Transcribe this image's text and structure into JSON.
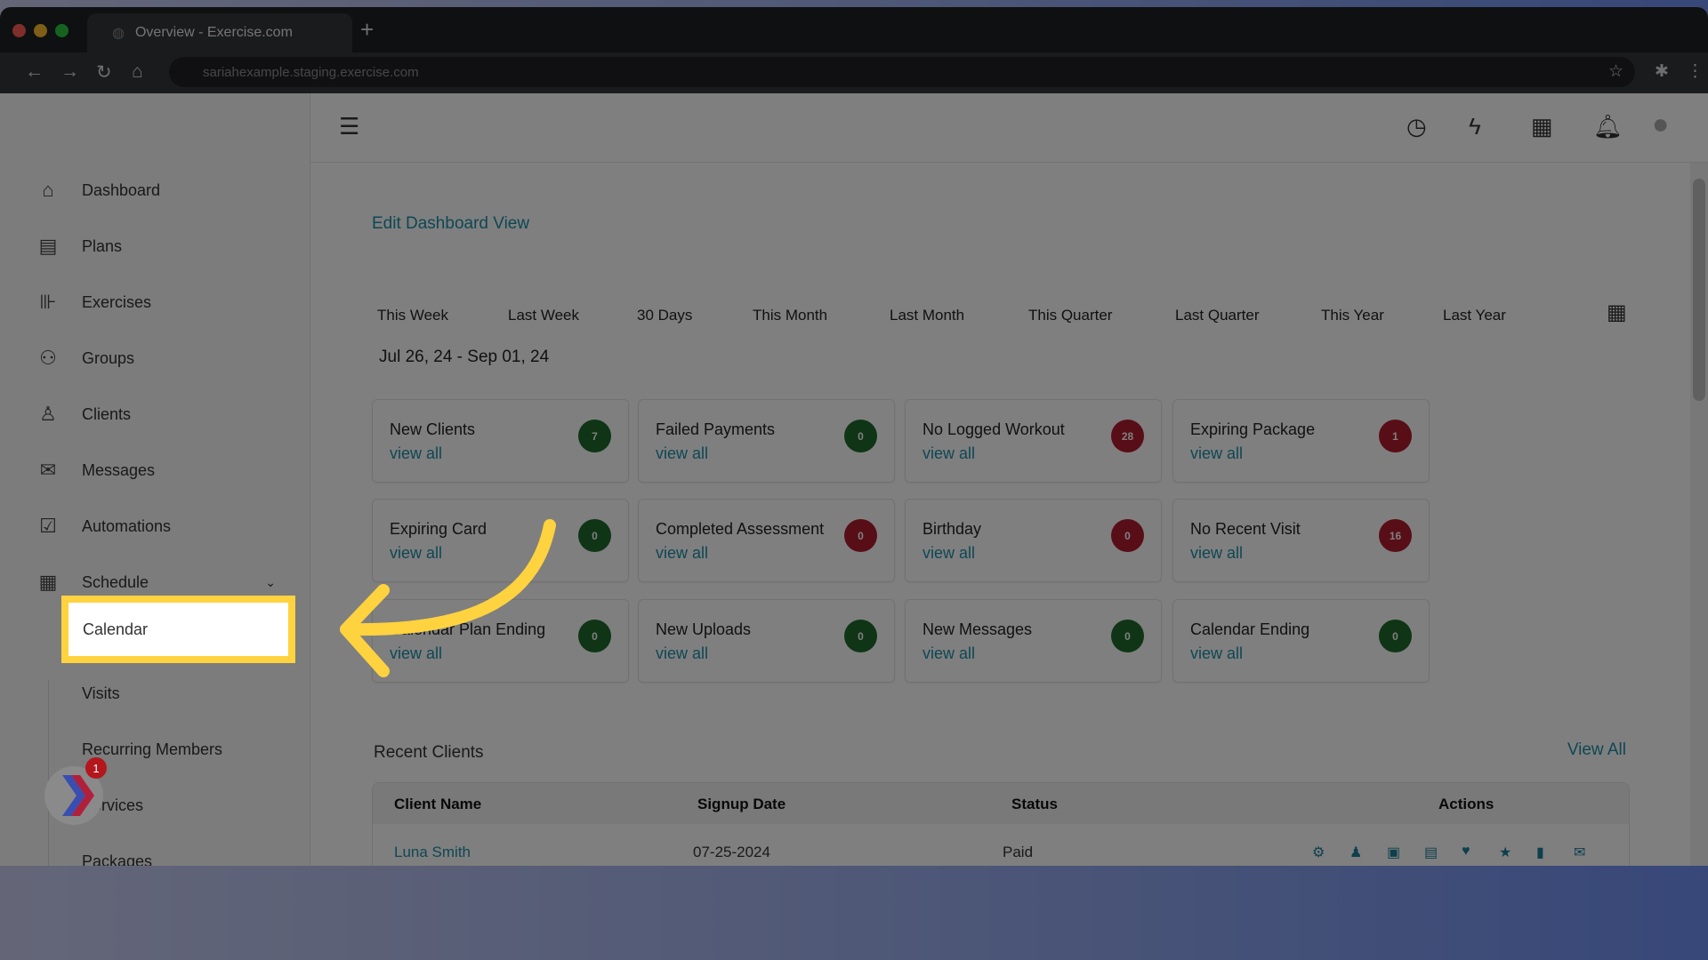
{
  "browser": {
    "tab_title": "Overview - Exercise.com",
    "url": "sariahexample.staging.exercise.com"
  },
  "sidebar": {
    "items": [
      {
        "label": "Dashboard",
        "icon": "home-icon"
      },
      {
        "label": "Plans",
        "icon": "clipboard-icon"
      },
      {
        "label": "Exercises",
        "icon": "dumbbell-icon"
      },
      {
        "label": "Groups",
        "icon": "users-icon"
      },
      {
        "label": "Clients",
        "icon": "user-icon"
      },
      {
        "label": "Messages",
        "icon": "mail-icon"
      },
      {
        "label": "Automations",
        "icon": "checkbox-icon"
      },
      {
        "label": "Schedule",
        "icon": "calendar-icon"
      }
    ],
    "schedule_sub": [
      "Calendar",
      "Visits",
      "Recurring Members",
      "Services",
      "Packages"
    ]
  },
  "chat_badge": "1",
  "main": {
    "edit_link": "Edit Dashboard View",
    "periods": [
      "This Week",
      "Last Week",
      "30 Days",
      "This Month",
      "Last Month",
      "This Quarter",
      "Last Quarter",
      "This Year",
      "Last Year"
    ],
    "date_range": "Jul 26, 24 - Sep 01, 24",
    "view_all_label": "view all",
    "cards": [
      {
        "title": "New Clients",
        "count": "7",
        "color": "#1f6b2c"
      },
      {
        "title": "Failed Payments",
        "count": "0",
        "color": "#1f6b2c"
      },
      {
        "title": "No Logged Workout",
        "count": "28",
        "color": "#b01c2e"
      },
      {
        "title": "Expiring Package",
        "count": "1",
        "color": "#b01c2e"
      },
      {
        "title": "Expiring Card",
        "count": "0",
        "color": "#1f6b2c"
      },
      {
        "title": "Completed Assessment",
        "count": "0",
        "color": "#b01c2e"
      },
      {
        "title": "Birthday",
        "count": "0",
        "color": "#b01c2e"
      },
      {
        "title": "No Recent Visit",
        "count": "16",
        "color": "#b01c2e"
      },
      {
        "title": "Calendar Plan Ending",
        "count": "0",
        "color": "#1f6b2c"
      },
      {
        "title": "New Uploads",
        "count": "0",
        "color": "#1f6b2c"
      },
      {
        "title": "New Messages",
        "count": "0",
        "color": "#1f6b2c"
      },
      {
        "title": "Calendar Ending",
        "count": "0",
        "color": "#1f6b2c"
      }
    ],
    "recent_clients": {
      "title": "Recent Clients",
      "view_all": "View All",
      "columns": [
        "Client Name",
        "Signup Date",
        "Status",
        "Actions"
      ],
      "rows": [
        {
          "name": "Luna Smith",
          "signup": "07-25-2024",
          "status": "Paid"
        }
      ],
      "action_icons": [
        "gear-icon",
        "user-icon",
        "calendar-check-icon",
        "document-icon",
        "heartbeat-icon",
        "star-icon",
        "bar-chart-icon",
        "envelope-icon"
      ]
    }
  },
  "highlight_color": "#ffd23f"
}
